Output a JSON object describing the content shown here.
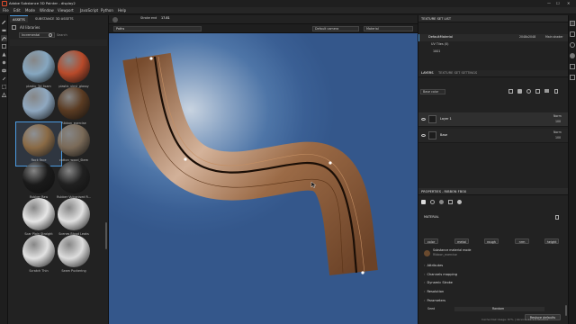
{
  "app": {
    "title": "Adobe Substance 3D Painter - display2",
    "window_controls": [
      "—",
      "☐",
      "✕"
    ]
  },
  "menu": [
    "File",
    "Edit",
    "Mode",
    "Window",
    "Viewport",
    "JavaScript",
    "Python",
    "Help"
  ],
  "context_bar": {
    "stroke_label": "Stroke end",
    "stroke_value": "17.81"
  },
  "assets": {
    "tabs": [
      "ASSETS",
      "SUBSTANCE 3D ASSETS"
    ],
    "library": "All libraries",
    "filter": "Incremental",
    "search_placeholder": "Search",
    "items": [
      {
        "label": "plastic_3d_foam",
        "color": "#86a7c0"
      },
      {
        "label": "plastic_vinyl_glossy",
        "color": "#b84a2a"
      },
      {
        "label": "Pocket Patch Regular",
        "color": "#8fa8c0"
      },
      {
        "label": "Ribbon_exercise",
        "color": "#5a3b22"
      },
      {
        "label": "Rock Face",
        "color": "#8a6a45"
      },
      {
        "label": "cotton_wood_Stem",
        "color": "#7a6a58"
      },
      {
        "label": "Rubber Raw",
        "color": "#1a1a1a"
      },
      {
        "label": "Rubber Vulcanised R...",
        "color": "#202020"
      },
      {
        "label": "Scar Plain Straight",
        "color": "#e6e6e6"
      },
      {
        "label": "Scenes Blood Leaks",
        "color": "#e0e0e0"
      },
      {
        "label": "Scratch Thin",
        "color": "#e2e2e2"
      },
      {
        "label": "Seam Puckering",
        "color": "#dddddd"
      }
    ]
  },
  "viewport": {
    "tab": "Paths",
    "camera": "Default camera",
    "mode": "Material"
  },
  "texture_set_list": {
    "header": "TEXTURE SET LIST",
    "set_name": "DefaultMaterial",
    "resolution": "2048x2048",
    "shader": "Main shader",
    "uv_tiles": "UV Tiles (0)",
    "uv_tile_id": "1001"
  },
  "layers": {
    "tabs": [
      "LAYERS",
      "TEXTURE SET SETTINGS"
    ],
    "channel": "Base color",
    "items": [
      {
        "name": "Layer 1",
        "blend": "Norm",
        "opacity": "100"
      },
      {
        "name": "Base",
        "blend": "Norm",
        "opacity": "100"
      }
    ]
  },
  "properties": {
    "header": "PROPERTIES - RIBBON FBOX",
    "material_label": "MATERIAL",
    "channels": [
      "color",
      "metal",
      "rough",
      "nrm",
      "height"
    ],
    "material_mode": "Substance material mode",
    "material_name": "Ribbon_exercise",
    "sections": [
      "Attributes",
      "Channels mapping",
      "Dynamic Stroke",
      "Resolution",
      "Parameters"
    ],
    "seed_label": "Seed",
    "seed_value": "Random",
    "restore_button": "Restore defaults"
  },
  "status": {
    "text": "Cache Disk Usage: 87% | Version: 11.1.0 Student"
  },
  "colors": {
    "accent": "#4b9ae0",
    "ribbon": "#8a5a35",
    "viewport_bg": "#3a5f94"
  }
}
